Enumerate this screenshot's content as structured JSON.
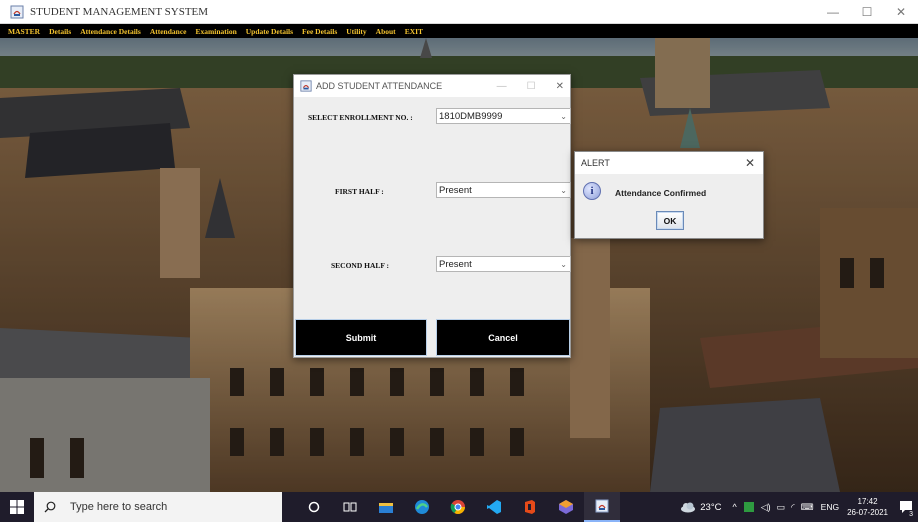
{
  "window": {
    "title": "STUDENT MANAGEMENT SYSTEM",
    "minimize": "—",
    "maximize": "☐",
    "close": "✕"
  },
  "menu": [
    "MASTER",
    "Details",
    "Attendance Details",
    "Attendance",
    "Examination",
    "Update Details",
    "Fee Details",
    "Utility",
    "About",
    "EXIT"
  ],
  "dialog": {
    "title": "ADD STUDENT ATTENDANCE",
    "enrollment_label": "SELECT ENROLLMENT NO. :",
    "enrollment_value": "1810DMB9999",
    "first_half_label": "FIRST HALF :",
    "first_half_value": "Present",
    "second_half_label": "SECOND HALF :",
    "second_half_value": "Present",
    "submit_label": "Submit",
    "cancel_label": "Cancel"
  },
  "alert": {
    "title": "ALERT",
    "message": "Attendance Confirmed",
    "ok_label": "OK",
    "info_glyph": "i"
  },
  "taskbar": {
    "search_placeholder": "Type here to search",
    "temperature": "23°C",
    "language": "ENG",
    "time": "17:42",
    "date": "26-07-2021",
    "notification_count": "3",
    "icons": [
      "task-view-icon",
      "file-explorer-icon",
      "edge-icon",
      "chrome-icon",
      "vscode-icon",
      "office-icon",
      "app-cube-icon",
      "java-icon"
    ]
  },
  "colors": {
    "menu_text": "#f4c430",
    "taskbar_bg": "#1f1c2b",
    "button_bg": "#000000"
  }
}
